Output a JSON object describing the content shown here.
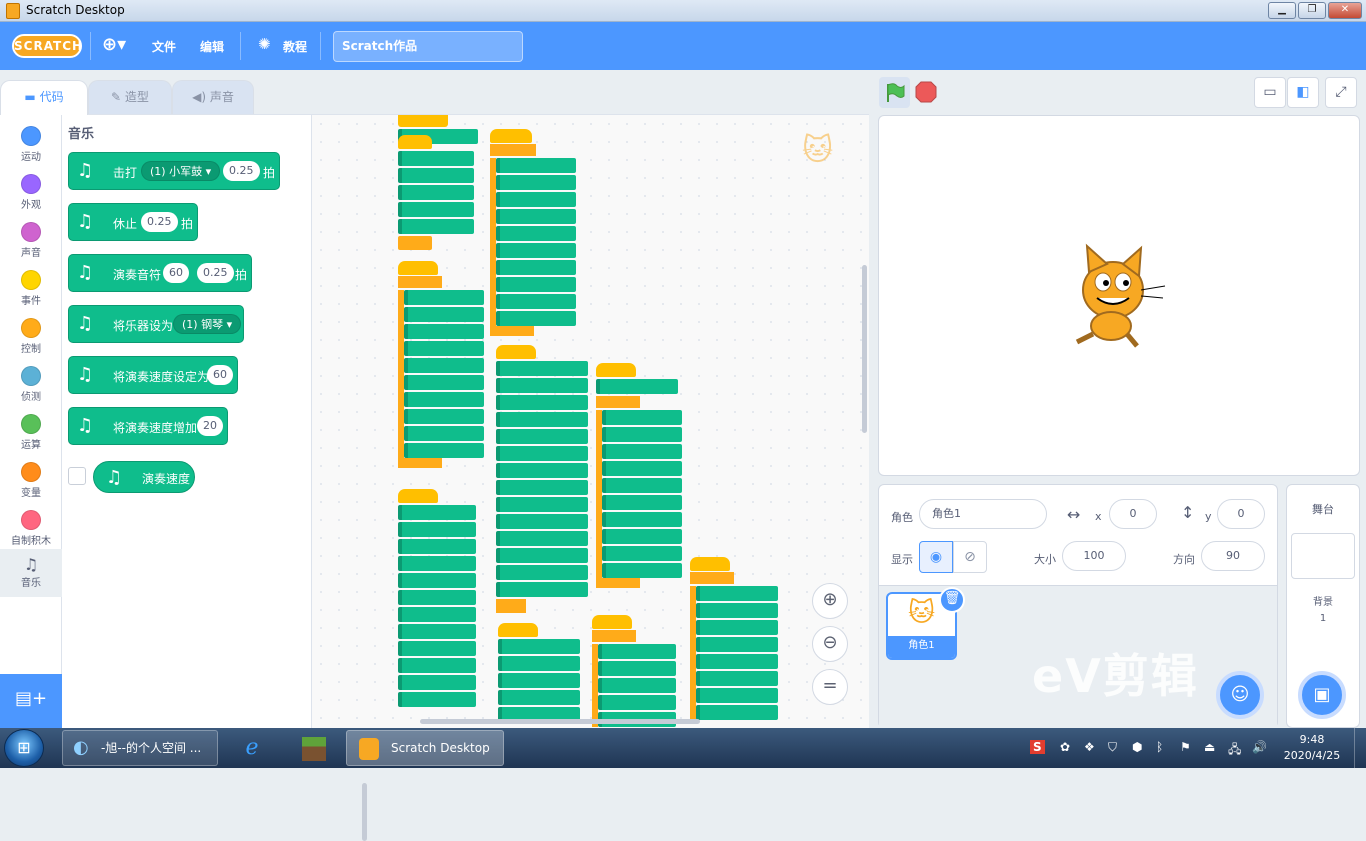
{
  "window": {
    "title": "Scratch Desktop"
  },
  "menu": {
    "logo": "SCRATCH",
    "file": "文件",
    "edit": "编辑",
    "tutorials": "教程",
    "project_name": "Scratch作品"
  },
  "tabs": {
    "code": "代码",
    "costumes": "造型",
    "sounds": "声音"
  },
  "categories": [
    {
      "label": "运动",
      "color": "#4c97ff"
    },
    {
      "label": "外观",
      "color": "#9966ff"
    },
    {
      "label": "声音",
      "color": "#cf63cf"
    },
    {
      "label": "事件",
      "color": "#ffd500"
    },
    {
      "label": "控制",
      "color": "#ffab19"
    },
    {
      "label": "侦测",
      "color": "#5cb1d6"
    },
    {
      "label": "运算",
      "color": "#59c059"
    },
    {
      "label": "变量",
      "color": "#ff8c1a"
    },
    {
      "label": "自制积木",
      "color": "#ff6680"
    },
    {
      "label": "音乐",
      "color": "#0fbd8c"
    }
  ],
  "palette": {
    "title": "音乐",
    "drum": {
      "label": "击打",
      "menu": "(1) 小军鼓",
      "beats": "0.25",
      "unit": "拍"
    },
    "rest": {
      "label": "休止",
      "beats": "0.25",
      "unit": "拍"
    },
    "note": {
      "label": "演奏音符",
      "note": "60",
      "beats": "0.25",
      "unit": "拍"
    },
    "instrument": {
      "label": "将乐器设为",
      "menu": "(1) 钢琴"
    },
    "set_tempo": {
      "label": "将演奏速度设定为",
      "value": "60"
    },
    "change_tempo": {
      "label": "将演奏速度增加",
      "value": "20"
    },
    "tempo_reporter": {
      "label": "演奏速度"
    }
  },
  "sprite_info": {
    "sprite_label": "角色",
    "sprite_name": "角色1",
    "x_label": "x",
    "x": "0",
    "y_label": "y",
    "y": "0",
    "show_label": "显示",
    "size_label": "大小",
    "size": "100",
    "direction_label": "方向",
    "direction": "90"
  },
  "sprite_list": [
    {
      "name": "角色1"
    }
  ],
  "stage_panel": {
    "label": "舞台",
    "backdrops_label": "背景",
    "backdrops_count": "1"
  },
  "watermark": "eV剪辑",
  "taskbar": {
    "items": [
      {
        "label": "-旭--的个人空间 ..."
      },
      {
        "label": "Scratch Desktop"
      }
    ],
    "time": "9:48",
    "date": "2020/4/25"
  }
}
